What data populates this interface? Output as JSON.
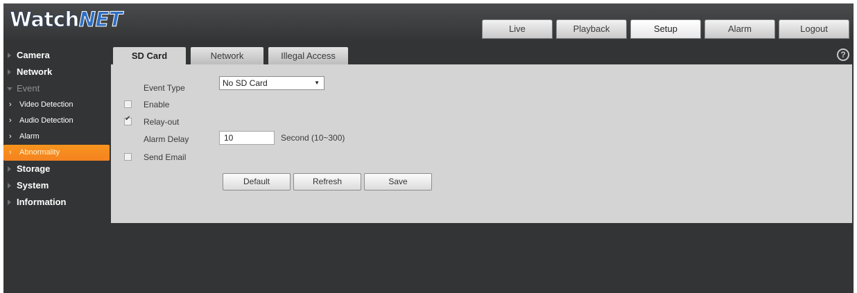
{
  "header": {
    "logo_main": "Watch",
    "logo_accent": "NET",
    "nav": [
      {
        "label": "Live",
        "active": false
      },
      {
        "label": "Playback",
        "active": false
      },
      {
        "label": "Setup",
        "active": true
      },
      {
        "label": "Alarm",
        "active": false
      },
      {
        "label": "Logout",
        "active": false
      }
    ]
  },
  "sidebar": {
    "items": [
      {
        "label": "Camera"
      },
      {
        "label": "Network"
      },
      {
        "label": "Event",
        "expanded": true
      },
      {
        "label": "Video Detection"
      },
      {
        "label": "Audio Detection"
      },
      {
        "label": "Alarm"
      },
      {
        "label": "Abnormality",
        "active": true
      },
      {
        "label": "Storage"
      },
      {
        "label": "System"
      },
      {
        "label": "Information"
      }
    ]
  },
  "subtabs": [
    {
      "label": "SD Card",
      "active": true
    },
    {
      "label": "Network",
      "active": false
    },
    {
      "label": "Illegal Access",
      "active": false
    }
  ],
  "help_icon": "?",
  "form": {
    "event_type_label": "Event Type",
    "event_type_value": "No SD Card",
    "enable_label": "Enable",
    "enable_checked": false,
    "relay_out_label": "Relay-out",
    "relay_out_checked": true,
    "alarm_delay_label": "Alarm Delay",
    "alarm_delay_value": "10",
    "alarm_delay_unit": "Second (10~300)",
    "send_email_label": "Send Email",
    "send_email_checked": false
  },
  "buttons": {
    "default": "Default",
    "refresh": "Refresh",
    "save": "Save"
  },
  "colors": {
    "background": "#333435",
    "panel": "#d4d4d4",
    "active_menu": "#f58220",
    "logo_accent": "#2e6fc4"
  }
}
